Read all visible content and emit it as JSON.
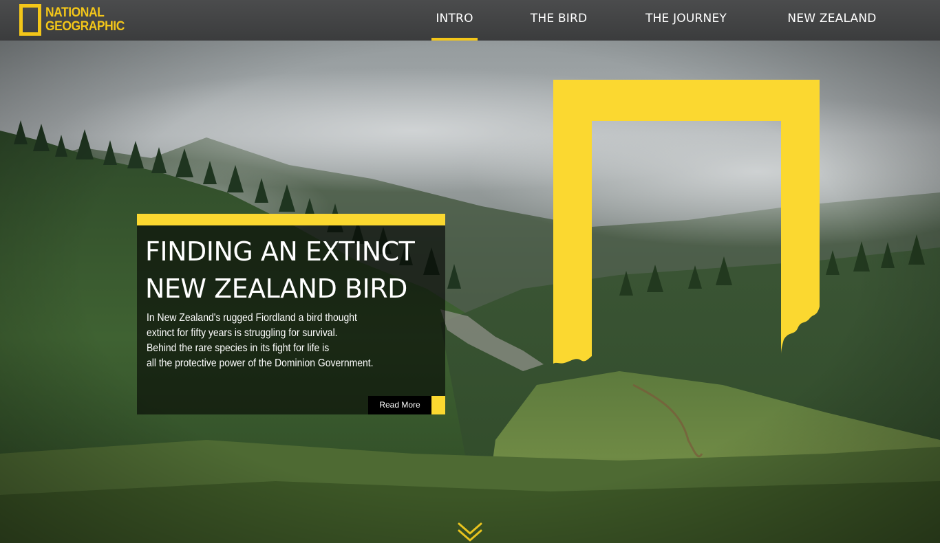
{
  "brand": {
    "logo_line1": "NATIONAL",
    "logo_line2": "GEOGRAPHIC",
    "accent_color": "#f3c619",
    "frame_color": "#fbd830"
  },
  "nav": {
    "items": [
      {
        "label": "INTRO",
        "active": true
      },
      {
        "label": "THE BIRD",
        "active": false
      },
      {
        "label": "THE JOURNEY",
        "active": false
      },
      {
        "label": "NEW ZEALAND",
        "active": false
      }
    ]
  },
  "hero": {
    "title_line1": "FINDING AN EXTINCT",
    "title_line2": "NEW ZEALAND BIRD",
    "body_lines": [
      "In New Zealand's rugged Fiordland a bird thought",
      "extinct for fifty years is struggling for survival.",
      "Behind the rare species in its fight for life is",
      "all the protective power of the Dominion Government."
    ],
    "read_more_label": "Read More"
  },
  "icons": {
    "logo": "national-geographic-frame-icon",
    "scroll": "double-chevron-down-icon"
  }
}
